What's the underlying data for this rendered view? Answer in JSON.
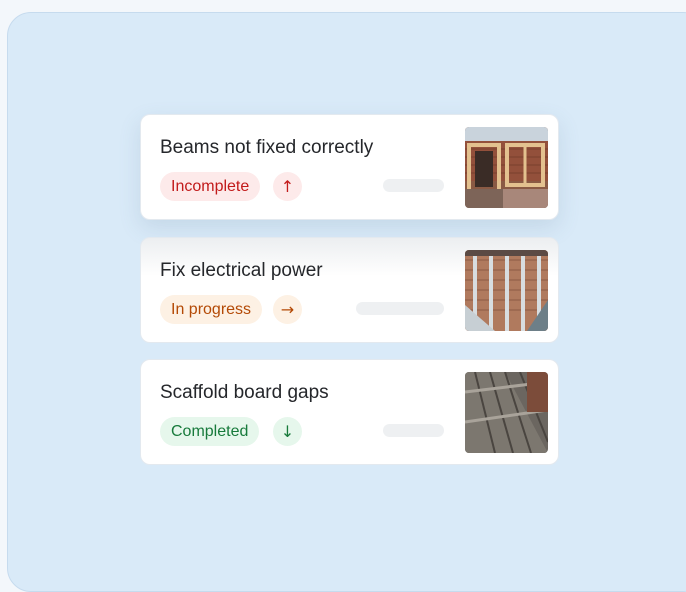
{
  "issues": [
    {
      "title": "Beams not fixed correctly",
      "status": "Incomplete",
      "status_color": "#c21b1b",
      "priority_icon": "arrow-up-icon",
      "arrow": "↑"
    },
    {
      "title": "Fix electrical power",
      "status": "In progress",
      "status_color": "#b44a06",
      "priority_icon": "arrow-right-icon",
      "arrow": "→"
    },
    {
      "title": "Scaffold board gaps",
      "status": "Completed",
      "status_color": "#177a3b",
      "priority_icon": "arrow-down-icon",
      "arrow": "↓"
    }
  ],
  "colors": {
    "panel_bg": "#d9eaf8",
    "card_bg": "#ffffff"
  }
}
